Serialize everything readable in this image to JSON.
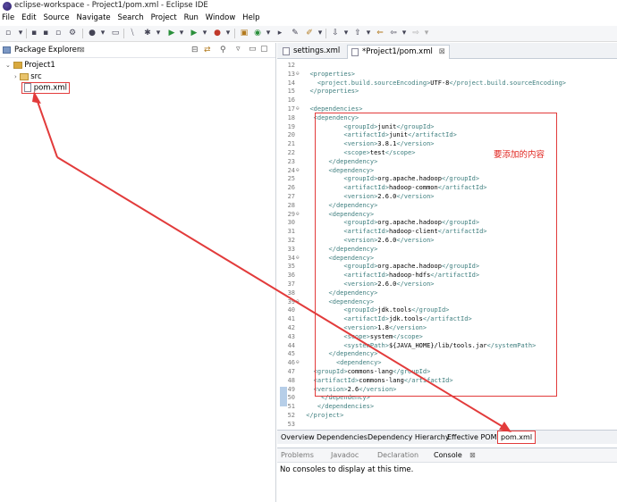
{
  "window": {
    "title": "eclipse-workspace - Project1/pom.xml - Eclipse IDE"
  },
  "menu": [
    "File",
    "Edit",
    "Source",
    "Navigate",
    "Search",
    "Project",
    "Run",
    "Window",
    "Help"
  ],
  "package_explorer": {
    "title": "Package Explorer",
    "tree": {
      "project": "Project1",
      "folder": "src",
      "file": "pom.xml"
    }
  },
  "editor": {
    "tabs": [
      {
        "label": "settings.xml"
      },
      {
        "label": "*Project1/pom.xml"
      }
    ],
    "lines": [
      {
        "n": "12",
        "fold": "",
        "code": ""
      },
      {
        "n": "13",
        "fold": "⊖",
        "code": "  <properties>"
      },
      {
        "n": "14",
        "fold": "",
        "code": "    <project.build.sourceEncoding>UTF-8</project.build.sourceEncoding>"
      },
      {
        "n": "15",
        "fold": "",
        "code": "  </properties>"
      },
      {
        "n": "16",
        "fold": "",
        "code": ""
      },
      {
        "n": "17",
        "fold": "⊖",
        "code": "  <dependencies>"
      },
      {
        "n": "18",
        "fold": "",
        "code": "   <dependency>"
      },
      {
        "n": "19",
        "fold": "",
        "code": "           <groupId>junit</groupId>"
      },
      {
        "n": "20",
        "fold": "",
        "code": "           <artifactId>junit</artifactId>"
      },
      {
        "n": "21",
        "fold": "",
        "code": "           <version>3.8.1</version>"
      },
      {
        "n": "22",
        "fold": "",
        "code": "           <scope>test</scope>"
      },
      {
        "n": "23",
        "fold": "",
        "code": "       </dependency>"
      },
      {
        "n": "24",
        "fold": "⊖",
        "code": "       <dependency>"
      },
      {
        "n": "25",
        "fold": "",
        "code": "           <groupId>org.apache.hadoop</groupId>"
      },
      {
        "n": "26",
        "fold": "",
        "code": "           <artifactId>hadoop-common</artifactId>"
      },
      {
        "n": "27",
        "fold": "",
        "code": "           <version>2.6.0</version>"
      },
      {
        "n": "28",
        "fold": "",
        "code": "       </dependency>"
      },
      {
        "n": "29",
        "fold": "⊖",
        "code": "       <dependency>"
      },
      {
        "n": "30",
        "fold": "",
        "code": "           <groupId>org.apache.hadoop</groupId>"
      },
      {
        "n": "31",
        "fold": "",
        "code": "           <artifactId>hadoop-client</artifactId>"
      },
      {
        "n": "32",
        "fold": "",
        "code": "           <version>2.6.0</version>"
      },
      {
        "n": "33",
        "fold": "",
        "code": "       </dependency>"
      },
      {
        "n": "34",
        "fold": "⊖",
        "code": "       <dependency>"
      },
      {
        "n": "35",
        "fold": "",
        "code": "           <groupId>org.apache.hadoop</groupId>"
      },
      {
        "n": "36",
        "fold": "",
        "code": "           <artifactId>hadoop-hdfs</artifactId>"
      },
      {
        "n": "37",
        "fold": "",
        "code": "           <version>2.6.0</version>"
      },
      {
        "n": "38",
        "fold": "",
        "code": "       </dependency>"
      },
      {
        "n": "39",
        "fold": "⊖",
        "code": "       <dependency>"
      },
      {
        "n": "40",
        "fold": "",
        "code": "           <groupId>jdk.tools</groupId>"
      },
      {
        "n": "41",
        "fold": "",
        "code": "           <artifactId>jdk.tools</artifactId>"
      },
      {
        "n": "42",
        "fold": "",
        "code": "           <version>1.8</version>"
      },
      {
        "n": "43",
        "fold": "",
        "code": "           <scope>system</scope>"
      },
      {
        "n": "44",
        "fold": "",
        "code": "           <systemPath>${JAVA_HOME}/lib/tools.jar</systemPath>"
      },
      {
        "n": "45",
        "fold": "",
        "code": "       </dependency>"
      },
      {
        "n": "46",
        "fold": "⊖",
        "code": "         <dependency>"
      },
      {
        "n": "47",
        "fold": "",
        "code": "   <groupId>commons-lang</groupId>"
      },
      {
        "n": "48",
        "fold": "",
        "code": "   <artifactId>commons-lang</artifactId>"
      },
      {
        "n": "49",
        "fold": "",
        "code": "   <version>2.6</version>"
      },
      {
        "n": "50",
        "fold": "",
        "code": "     </dependency>"
      },
      {
        "n": "51",
        "fold": "",
        "code": "    </dependencies>"
      },
      {
        "n": "52",
        "fold": "",
        "code": " </project>"
      },
      {
        "n": "53",
        "fold": "",
        "code": ""
      }
    ],
    "annotation": "要添加的内容",
    "bottom_tabs": [
      "Overview",
      "Dependencies",
      "Dependency Hierarchy",
      "Effective POM",
      "pom.xml"
    ]
  },
  "console": {
    "tabs": [
      "Problems",
      "Javadoc",
      "Declaration",
      "Console"
    ],
    "message": "No consoles to display at this time."
  },
  "colors": {
    "annotation_red": "#e23b3b",
    "tag_teal": "#3f7f7f"
  }
}
